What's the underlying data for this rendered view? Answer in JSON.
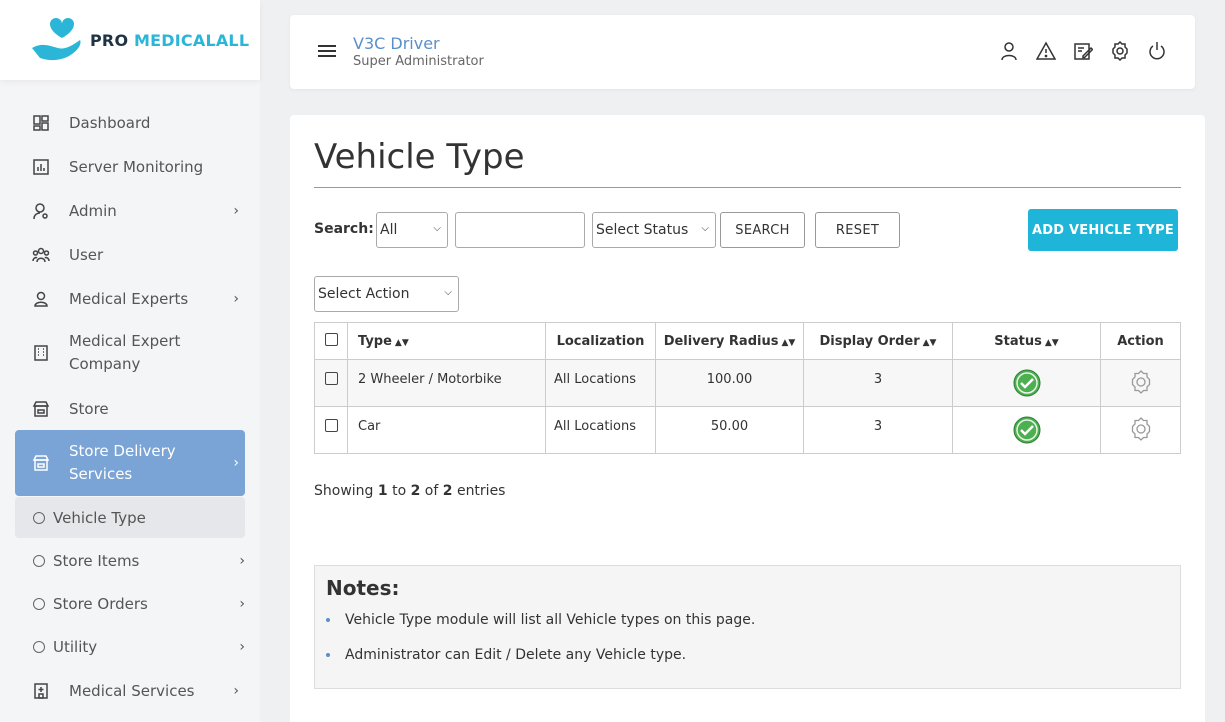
{
  "brand": {
    "pro": "PRO",
    "med": "MEDICALALL"
  },
  "sidebar": {
    "items": [
      {
        "label": "Dashboard",
        "icon": "dashboard-icon"
      },
      {
        "label": "Server Monitoring",
        "icon": "chart-icon"
      },
      {
        "label": "Admin",
        "icon": "admin-icon"
      },
      {
        "label": "User",
        "icon": "users-icon"
      },
      {
        "label": "Medical Experts",
        "icon": "person-icon"
      },
      {
        "label": "Medical Expert Company",
        "icon": "building-icon"
      },
      {
        "label": "Store",
        "icon": "store-icon"
      },
      {
        "label": "Store Delivery Services",
        "icon": "store-icon"
      }
    ],
    "sub": [
      {
        "label": "Vehicle Type"
      },
      {
        "label": "Store Items"
      },
      {
        "label": "Store Orders"
      },
      {
        "label": "Utility"
      }
    ],
    "medical_services": "Medical Services"
  },
  "header": {
    "title": "V3C Driver",
    "subtitle": "Super Administrator"
  },
  "main": {
    "title": "Vehicle Type",
    "search_label": "Search:",
    "filter_all": "All",
    "select_status": "Select Status",
    "search_btn": "SEARCH",
    "reset_btn": "RESET",
    "add_btn": "ADD VEHICLE TYPE",
    "select_action": "Select Action"
  },
  "table": {
    "headers": [
      "Type",
      "Localization",
      "Delivery Radius",
      "Display Order",
      "Status",
      "Action"
    ],
    "rows": [
      {
        "type": "2 Wheeler / Motorbike",
        "localization": "All Locations",
        "radius": "100.00",
        "order": "3"
      },
      {
        "type": "Car",
        "localization": "All Locations",
        "radius": "50.00",
        "order": "3"
      }
    ]
  },
  "showing": {
    "a": "Showing ",
    "from": "1",
    "b": " to ",
    "to": "2",
    "c": " of ",
    "total": "2",
    "d": " entries"
  },
  "notes": {
    "title": "Notes:",
    "items": [
      "Vehicle Type module will list all Vehicle types on this page.",
      "Administrator can Edit / Delete any Vehicle type."
    ]
  },
  "colors": {
    "accent": "#1fb5d9",
    "active_nav": "#7aa3d6",
    "status_ok": "#4caf50"
  }
}
